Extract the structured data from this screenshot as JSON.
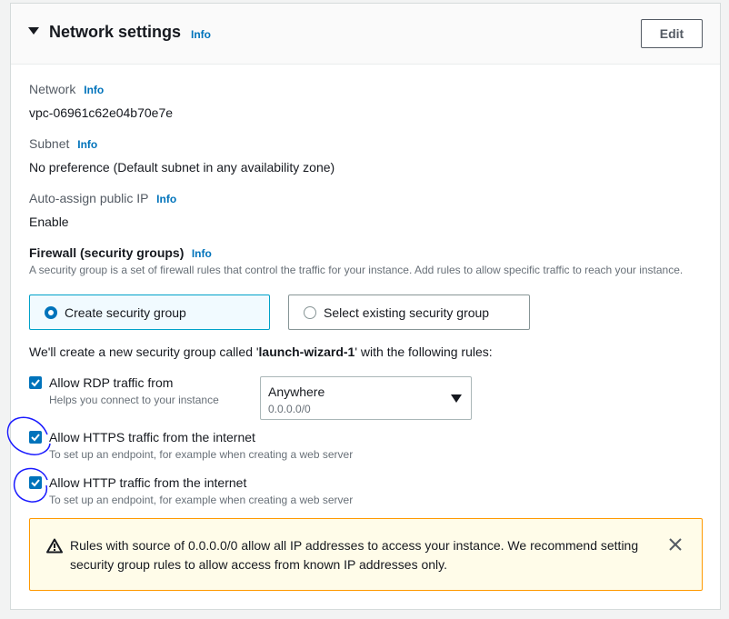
{
  "header": {
    "title": "Network settings",
    "info": "Info",
    "edit_label": "Edit"
  },
  "network": {
    "label": "Network",
    "info": "Info",
    "value": "vpc-06961c62e04b70e7e"
  },
  "subnet": {
    "label": "Subnet",
    "info": "Info",
    "value": "No preference (Default subnet in any availability zone)"
  },
  "auto_ip": {
    "label": "Auto-assign public IP",
    "info": "Info",
    "value": "Enable"
  },
  "firewall": {
    "title": "Firewall (security groups)",
    "info": "Info",
    "description": "A security group is a set of firewall rules that control the traffic for your instance. Add rules to allow specific traffic to reach your instance.",
    "options": [
      {
        "label": "Create security group",
        "selected": true
      },
      {
        "label": "Select existing security group",
        "selected": false
      }
    ],
    "create_prefix": "We'll create a new security group called '",
    "group_name": "launch-wizard-1",
    "create_suffix": "' with the following rules:"
  },
  "rules": [
    {
      "title": "Allow RDP traffic from",
      "desc": "Helps you connect to your instance",
      "checked": true
    },
    {
      "title": "Allow HTTPS traffic from the internet",
      "desc": "To set up an endpoint, for example when creating a web server",
      "checked": true
    },
    {
      "title": "Allow HTTP traffic from the internet",
      "desc": "To set up an endpoint, for example when creating a web server",
      "checked": true
    }
  ],
  "source_select": {
    "value": "Anywhere",
    "sub": "0.0.0.0/0"
  },
  "warning": {
    "text": "Rules with source of 0.0.0.0/0 allow all IP addresses to access your instance. We recommend setting security group rules to allow access from known IP addresses only."
  },
  "colors": {
    "accent": "#0073bb",
    "warning_bg": "#fffce9",
    "warning_border": "#ff9900",
    "annotation": "#1a1aff"
  }
}
